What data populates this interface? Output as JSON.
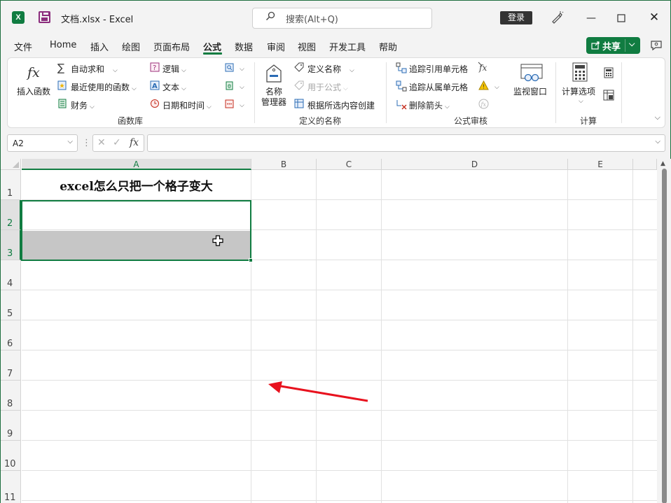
{
  "titlebar": {
    "app_icon_letter": "X",
    "title": "文档.xlsx  -  Excel",
    "search_placeholder": "搜索(Alt+Q)",
    "login_label": "登录",
    "minimize_glyph": "—",
    "close_glyph": "✕"
  },
  "menu_tabs": [
    {
      "label": "文件"
    },
    {
      "label": "Home"
    },
    {
      "label": "插入"
    },
    {
      "label": "绘图"
    },
    {
      "label": "页面布局"
    },
    {
      "label": "公式",
      "active": true
    },
    {
      "label": "数据"
    },
    {
      "label": "审阅"
    },
    {
      "label": "视图"
    },
    {
      "label": "开发工具"
    },
    {
      "label": "帮助"
    }
  ],
  "share": {
    "label": "共享",
    "chevron": "⌵"
  },
  "ribbon": {
    "function_library": {
      "insert_function": "插入函数",
      "autosum": "自动求和",
      "recently_used": "最近使用的函数",
      "financial": "财务",
      "logical": "逻辑",
      "text": "文本",
      "date_time": "日期和时间",
      "group_label": "函数库"
    },
    "defined_names": {
      "name_manager_line1": "名称",
      "name_manager_line2": "管理器",
      "define_name": "定义名称",
      "use_in_formula": "用于公式",
      "create_from_selection": "根据所选内容创建",
      "group_label": "定义的名称"
    },
    "formula_auditing": {
      "trace_precedents": "追踪引用单元格",
      "trace_dependents": "追踪从属单元格",
      "remove_arrows": "删除箭头",
      "watch_window": "监视窗口",
      "group_label": "公式审核"
    },
    "calculation": {
      "calc_options": "计算选项",
      "group_label": "计算"
    },
    "chevron": "⌵"
  },
  "formula_bar": {
    "name_box": "A2",
    "cancel_glyph": "✕",
    "enter_glyph": "✓",
    "fx_label": "fx",
    "dots": "⋮",
    "formula": ""
  },
  "sheet": {
    "columns": [
      "A",
      "B",
      "C",
      "D",
      "E"
    ],
    "rows": [
      "1",
      "2",
      "3",
      "4",
      "5",
      "6",
      "7",
      "8",
      "9",
      "10",
      "11"
    ],
    "cell_a1": "excel怎么只把一个格子变大",
    "selected_range": "A2:A3",
    "highlight_color": "#c6c6c6",
    "accent_color": "#107c41",
    "annotation_arrow_color": "#e8121e"
  }
}
